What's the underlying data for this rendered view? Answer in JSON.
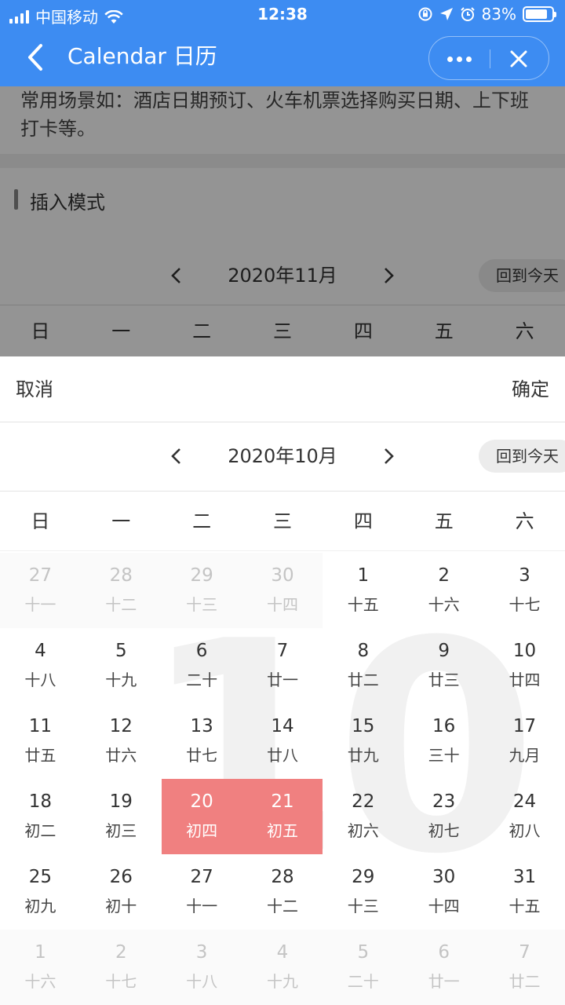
{
  "status": {
    "carrier": "中国移动",
    "time": "12:38",
    "battery": "83%",
    "battery_level": 0.83
  },
  "nav": {
    "title": "Calendar 日历"
  },
  "background": {
    "description": "常用场景如：酒店日期预订、火车机票选择购买日期、上下班打卡等。",
    "section_title": "插入模式",
    "month_label": "2020年11月",
    "today_label": "回到今天",
    "weekdays": [
      "日",
      "一",
      "二",
      "三",
      "四",
      "五",
      "六"
    ]
  },
  "popup": {
    "cancel_label": "取消",
    "confirm_label": "确定",
    "month_label": "2020年10月",
    "today_label": "回到今天",
    "watermark": "10",
    "weekdays": [
      "日",
      "一",
      "二",
      "三",
      "四",
      "五",
      "六"
    ],
    "rows": [
      [
        {
          "day": "27",
          "lunar": "十一",
          "state": "other"
        },
        {
          "day": "28",
          "lunar": "十二",
          "state": "other"
        },
        {
          "day": "29",
          "lunar": "十三",
          "state": "other"
        },
        {
          "day": "30",
          "lunar": "十四",
          "state": "other"
        },
        {
          "day": "1",
          "lunar": "十五",
          "state": "normal"
        },
        {
          "day": "2",
          "lunar": "十六",
          "state": "normal"
        },
        {
          "day": "3",
          "lunar": "十七",
          "state": "normal"
        }
      ],
      [
        {
          "day": "4",
          "lunar": "十八",
          "state": "normal"
        },
        {
          "day": "5",
          "lunar": "十九",
          "state": "normal"
        },
        {
          "day": "6",
          "lunar": "二十",
          "state": "normal"
        },
        {
          "day": "7",
          "lunar": "廿一",
          "state": "normal"
        },
        {
          "day": "8",
          "lunar": "廿二",
          "state": "normal"
        },
        {
          "day": "9",
          "lunar": "廿三",
          "state": "normal"
        },
        {
          "day": "10",
          "lunar": "廿四",
          "state": "normal"
        }
      ],
      [
        {
          "day": "11",
          "lunar": "廿五",
          "state": "normal"
        },
        {
          "day": "12",
          "lunar": "廿六",
          "state": "normal"
        },
        {
          "day": "13",
          "lunar": "廿七",
          "state": "normal"
        },
        {
          "day": "14",
          "lunar": "廿八",
          "state": "normal"
        },
        {
          "day": "15",
          "lunar": "廿九",
          "state": "normal"
        },
        {
          "day": "16",
          "lunar": "三十",
          "state": "normal"
        },
        {
          "day": "17",
          "lunar": "九月",
          "state": "normal"
        }
      ],
      [
        {
          "day": "18",
          "lunar": "初二",
          "state": "normal"
        },
        {
          "day": "19",
          "lunar": "初三",
          "state": "normal"
        },
        {
          "day": "20",
          "lunar": "初四",
          "state": "selected"
        },
        {
          "day": "21",
          "lunar": "初五",
          "state": "selected"
        },
        {
          "day": "22",
          "lunar": "初六",
          "state": "normal"
        },
        {
          "day": "23",
          "lunar": "初七",
          "state": "normal"
        },
        {
          "day": "24",
          "lunar": "初八",
          "state": "normal"
        }
      ],
      [
        {
          "day": "25",
          "lunar": "初九",
          "state": "normal"
        },
        {
          "day": "26",
          "lunar": "初十",
          "state": "normal"
        },
        {
          "day": "27",
          "lunar": "十一",
          "state": "normal"
        },
        {
          "day": "28",
          "lunar": "十二",
          "state": "normal"
        },
        {
          "day": "29",
          "lunar": "十三",
          "state": "normal"
        },
        {
          "day": "30",
          "lunar": "十四",
          "state": "normal"
        },
        {
          "day": "31",
          "lunar": "十五",
          "state": "normal"
        }
      ],
      [
        {
          "day": "1",
          "lunar": "十六",
          "state": "other"
        },
        {
          "day": "2",
          "lunar": "十七",
          "state": "other"
        },
        {
          "day": "3",
          "lunar": "十八",
          "state": "other"
        },
        {
          "day": "4",
          "lunar": "十九",
          "state": "other"
        },
        {
          "day": "5",
          "lunar": "二十",
          "state": "other"
        },
        {
          "day": "6",
          "lunar": "廿一",
          "state": "other"
        },
        {
          "day": "7",
          "lunar": "廿二",
          "state": "other"
        }
      ]
    ]
  },
  "colors": {
    "nav_blue": "#3d8cf2",
    "selected": "#f08080",
    "muted": "#c4c4c4"
  },
  "icons": [
    "signal-icon",
    "wifi-icon",
    "lock-rotation-icon",
    "location-icon",
    "alarm-icon",
    "battery-icon",
    "back-icon",
    "more-icon",
    "close-icon",
    "chevron-left-icon",
    "chevron-right-icon"
  ]
}
